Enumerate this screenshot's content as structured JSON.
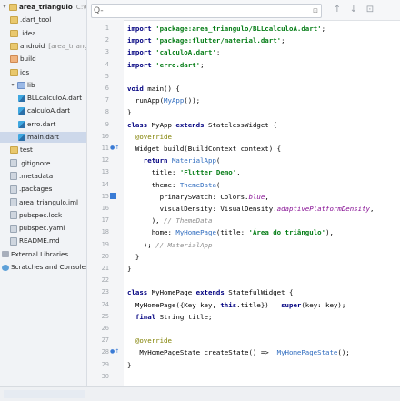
{
  "project_tree": [
    {
      "label": "area_triangulo",
      "suffix": "C:\\Users",
      "icon": "folder-icon",
      "depth": 0,
      "bold": true,
      "expanded": true
    },
    {
      "label": ".dart_tool",
      "icon": "folder-icon",
      "depth": 1
    },
    {
      "label": ".idea",
      "icon": "folder-icon",
      "depth": 1
    },
    {
      "label": "android",
      "suffix": "[area_triang",
      "icon": "folder-icon",
      "depth": 1,
      "bold": false
    },
    {
      "label": "build",
      "icon": "folder-orange-icon",
      "depth": 1
    },
    {
      "label": "ios",
      "icon": "folder-icon",
      "depth": 1
    },
    {
      "label": "lib",
      "icon": "folder-blue-icon",
      "depth": 1,
      "expanded": true
    },
    {
      "label": "BLLcalculoA.dart",
      "icon": "dart-file-icon",
      "depth": 2
    },
    {
      "label": "calculoA.dart",
      "icon": "dart-file-icon",
      "depth": 2
    },
    {
      "label": "erro.dart",
      "icon": "dart-file-icon",
      "depth": 2
    },
    {
      "label": "main.dart",
      "icon": "dart-file-icon",
      "depth": 2,
      "selected": true
    },
    {
      "label": "test",
      "icon": "folder-icon",
      "depth": 1
    },
    {
      "label": ".gitignore",
      "icon": "file-icon",
      "depth": 1
    },
    {
      "label": ".metadata",
      "icon": "file-icon",
      "depth": 1
    },
    {
      "label": ".packages",
      "icon": "file-icon",
      "depth": 1
    },
    {
      "label": "area_triangulo.iml",
      "icon": "file-icon",
      "depth": 1
    },
    {
      "label": "pubspec.lock",
      "icon": "file-icon",
      "depth": 1
    },
    {
      "label": "pubspec.yaml",
      "icon": "file-icon",
      "depth": 1
    },
    {
      "label": "README.md",
      "icon": "file-icon",
      "depth": 1
    },
    {
      "label": "External Libraries",
      "icon": "library-icon",
      "depth": 0
    },
    {
      "label": "Scratches and Consoles",
      "icon": "scratch-icon",
      "depth": 0
    }
  ],
  "search": {
    "placeholder": "Q-",
    "regex_hint": "⊡"
  },
  "toolbar": {
    "prev": "↑",
    "next": "↓",
    "filter": "⊡"
  },
  "line_numbers": [
    "1",
    "2",
    "3",
    "4",
    "5",
    "6",
    "7",
    "8",
    "9",
    "10",
    "11",
    "12",
    "13",
    "14",
    "15",
    "16",
    "17",
    "18",
    "19",
    "20",
    "21",
    "22",
    "23",
    "24",
    "25",
    "26",
    "27",
    "28",
    "29",
    "30"
  ],
  "gutter_marks": {
    "11": "●↑",
    "15": "■",
    "28": "●↑"
  },
  "code_lines": [
    [
      {
        "t": "kw",
        "v": "import "
      },
      {
        "t": "str",
        "v": "'package:area_triangulo/BLLcalculoA.dart'"
      },
      {
        "t": "plain",
        "v": ";"
      }
    ],
    [
      {
        "t": "kw",
        "v": "import "
      },
      {
        "t": "str",
        "v": "'package:flutter/material.dart'"
      },
      {
        "t": "plain",
        "v": ";"
      }
    ],
    [
      {
        "t": "kw",
        "v": "import "
      },
      {
        "t": "str",
        "v": "'calculoA.dart'"
      },
      {
        "t": "plain",
        "v": ";"
      }
    ],
    [
      {
        "t": "kw",
        "v": "import "
      },
      {
        "t": "str",
        "v": "'erro.dart'"
      },
      {
        "t": "plain",
        "v": ";"
      }
    ],
    [],
    [
      {
        "t": "kw",
        "v": "void "
      },
      {
        "t": "plain",
        "v": "main() {"
      }
    ],
    [
      {
        "t": "plain",
        "v": "  runApp("
      },
      {
        "t": "cls",
        "v": "MyApp"
      },
      {
        "t": "plain",
        "v": "());"
      }
    ],
    [
      {
        "t": "plain",
        "v": "}"
      }
    ],
    [
      {
        "t": "kw",
        "v": "class "
      },
      {
        "t": "plain",
        "v": "MyApp "
      },
      {
        "t": "kw",
        "v": "extends "
      },
      {
        "t": "plain",
        "v": "StatelessWidget {"
      }
    ],
    [
      {
        "t": "anno",
        "v": "  @override"
      }
    ],
    [
      {
        "t": "plain",
        "v": "  Widget build(BuildContext context) {"
      }
    ],
    [
      {
        "t": "kw",
        "v": "    return "
      },
      {
        "t": "cls",
        "v": "MaterialApp"
      },
      {
        "t": "plain",
        "v": "("
      }
    ],
    [
      {
        "t": "plain",
        "v": "      title: "
      },
      {
        "t": "str",
        "v": "'Flutter Demo'"
      },
      {
        "t": "plain",
        "v": ","
      }
    ],
    [
      {
        "t": "plain",
        "v": "      theme: "
      },
      {
        "t": "cls",
        "v": "ThemeData"
      },
      {
        "t": "plain",
        "v": "("
      }
    ],
    [
      {
        "t": "plain",
        "v": "        primarySwatch: Colors."
      },
      {
        "t": "purple",
        "v": "blue"
      },
      {
        "t": "plain",
        "v": ","
      }
    ],
    [
      {
        "t": "plain",
        "v": "        visualDensity: VisualDensity."
      },
      {
        "t": "purple",
        "v": "adaptivePlatformDensity"
      },
      {
        "t": "plain",
        "v": ","
      }
    ],
    [
      {
        "t": "plain",
        "v": "      ), "
      },
      {
        "t": "cmt",
        "v": "// ThemeData"
      }
    ],
    [
      {
        "t": "plain",
        "v": "      home: "
      },
      {
        "t": "cls",
        "v": "MyHomePage"
      },
      {
        "t": "plain",
        "v": "(title: "
      },
      {
        "t": "str",
        "v": "'Área do triângulo'"
      },
      {
        "t": "plain",
        "v": "),"
      }
    ],
    [
      {
        "t": "plain",
        "v": "    ); "
      },
      {
        "t": "cmt",
        "v": "// MaterialApp"
      }
    ],
    [
      {
        "t": "plain",
        "v": "  }"
      }
    ],
    [
      {
        "t": "plain",
        "v": "}"
      }
    ],
    [],
    [
      {
        "t": "kw",
        "v": "class "
      },
      {
        "t": "plain",
        "v": "MyHomePage "
      },
      {
        "t": "kw",
        "v": "extends "
      },
      {
        "t": "plain",
        "v": "StatefulWidget {"
      }
    ],
    [
      {
        "t": "plain",
        "v": "  MyHomePage({Key key, "
      },
      {
        "t": "kw",
        "v": "this"
      },
      {
        "t": "plain",
        "v": ".title}) : "
      },
      {
        "t": "kw",
        "v": "super"
      },
      {
        "t": "plain",
        "v": "(key: key);"
      }
    ],
    [
      {
        "t": "kw",
        "v": "  final "
      },
      {
        "t": "plain",
        "v": "String title;"
      }
    ],
    [],
    [
      {
        "t": "anno",
        "v": "  @override"
      }
    ],
    [
      {
        "t": "plain",
        "v": "  _MyHomePageState createState() => "
      },
      {
        "t": "cls",
        "v": "_MyHomePageState"
      },
      {
        "t": "plain",
        "v": "();"
      }
    ],
    [
      {
        "t": "plain",
        "v": "}"
      }
    ],
    []
  ]
}
